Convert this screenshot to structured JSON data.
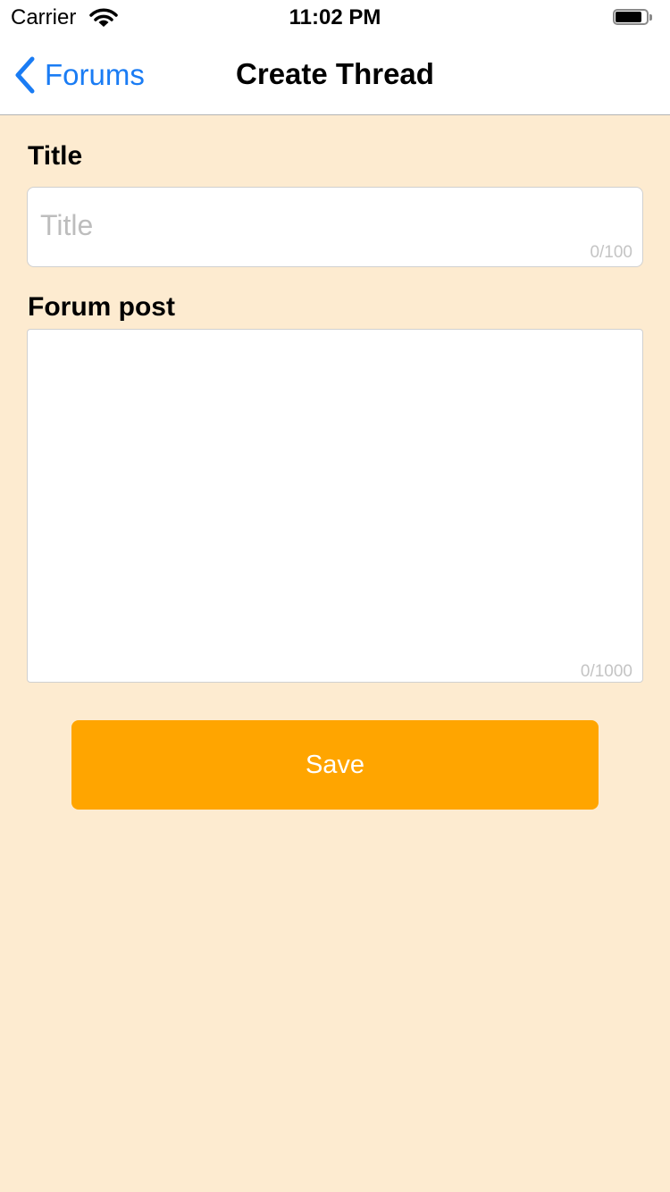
{
  "status_bar": {
    "carrier": "Carrier",
    "time": "11:02 PM",
    "battery_level": 0.85,
    "icons": [
      "wifi-icon",
      "battery-icon"
    ]
  },
  "nav": {
    "back_label": "Forums",
    "back_icon": "chevron-left-icon",
    "title": "Create Thread"
  },
  "form": {
    "title_label": "Title",
    "title_placeholder": "Title",
    "title_value": "",
    "title_counter": "0/100",
    "post_label": "Forum post",
    "post_value": "",
    "post_counter": "0/1000",
    "save_label": "Save"
  },
  "colors": {
    "background": "#FDEBD0",
    "accent": "#FFA500",
    "link": "#1A7CF4"
  }
}
